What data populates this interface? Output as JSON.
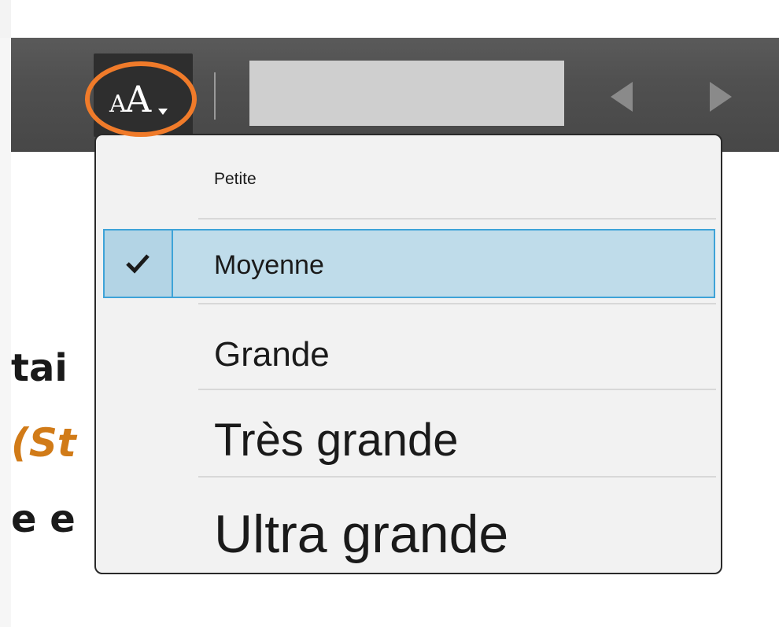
{
  "toolbar": {
    "font_size_button": {
      "icon": "font-size-icon",
      "glyph": "AA"
    },
    "search_placeholder": "",
    "nav": {
      "prev_icon": "arrow-left-icon",
      "next_icon": "arrow-right-icon"
    }
  },
  "background_text": {
    "line1": "tai",
    "line2": "(St",
    "line3": "e e"
  },
  "font_size_menu": {
    "items": [
      {
        "label": "Petite",
        "selected": false
      },
      {
        "label": "Moyenne",
        "selected": true
      },
      {
        "label": "Grande",
        "selected": false
      },
      {
        "label": "Très grande",
        "selected": false
      },
      {
        "label": "Ultra grande",
        "selected": false
      }
    ]
  },
  "colors": {
    "highlight_ring": "#f07b2a",
    "selected_bg": "#bfdcea",
    "selected_border": "#3ea3d8",
    "toolbar_bg": "#4e4e4e"
  }
}
